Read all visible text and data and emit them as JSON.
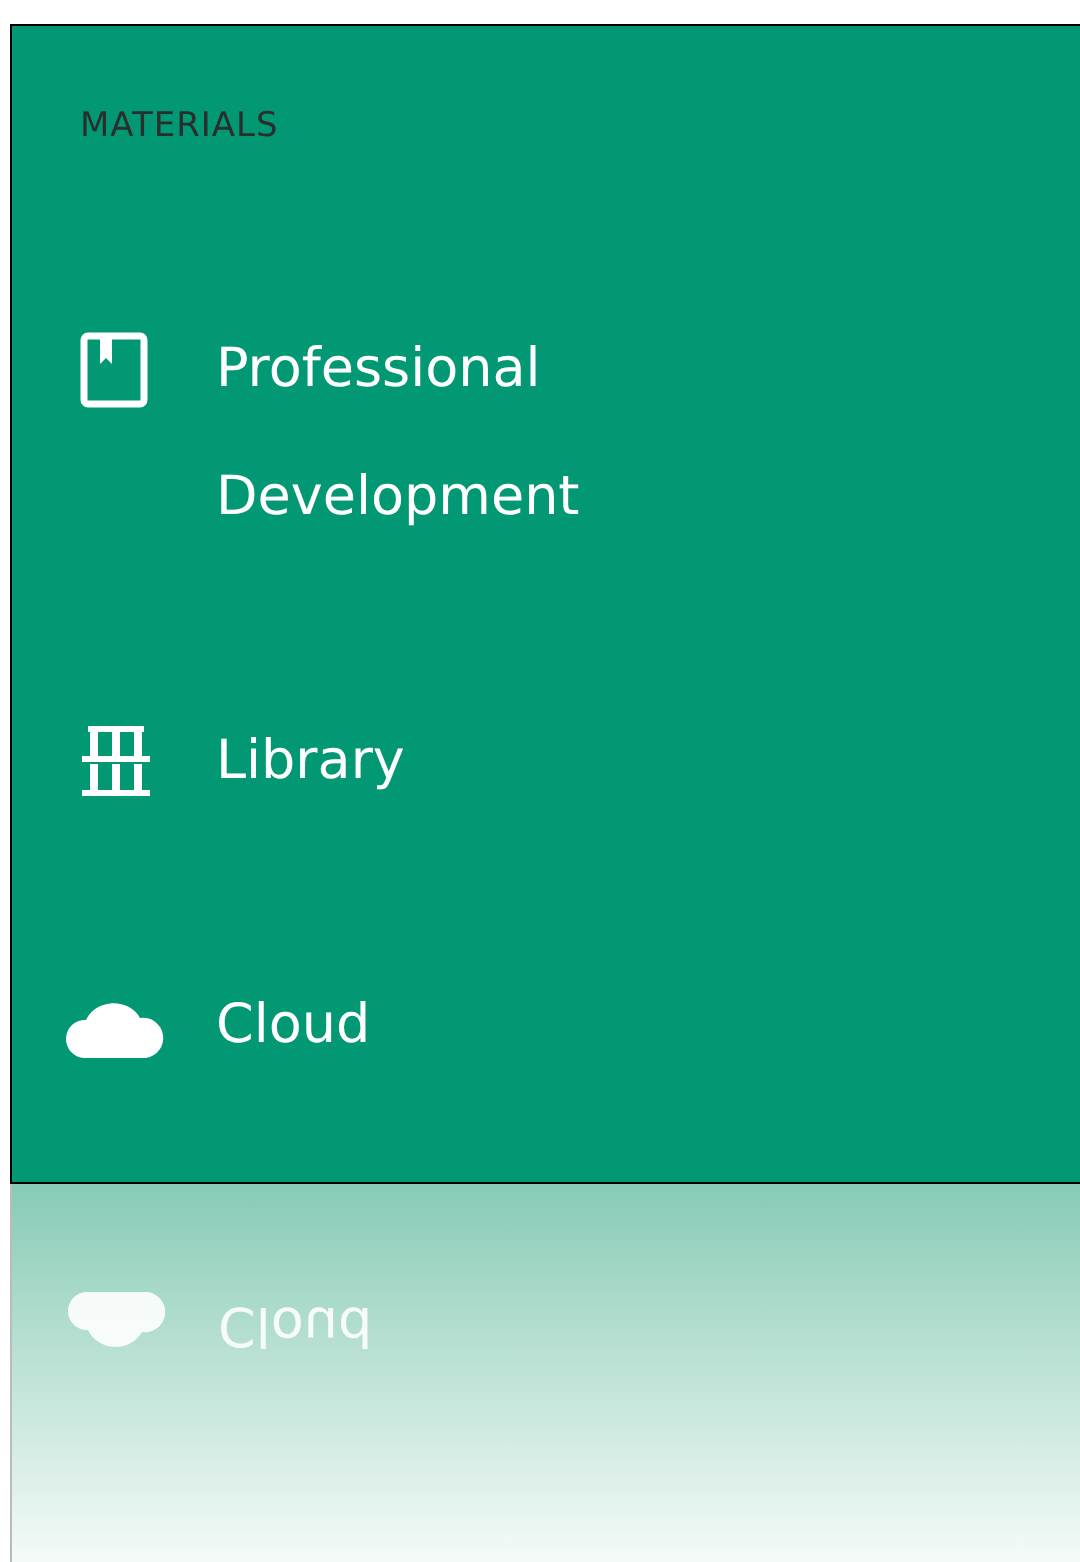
{
  "sidebar": {
    "heading": "MATERIALS",
    "items": [
      {
        "kind": "book",
        "label": "Professional Development"
      },
      {
        "kind": "library",
        "label": "Library"
      },
      {
        "kind": "cloud",
        "label": "Cloud"
      }
    ]
  },
  "reflection": {
    "kind": "cloud",
    "label": "Cloud"
  }
}
